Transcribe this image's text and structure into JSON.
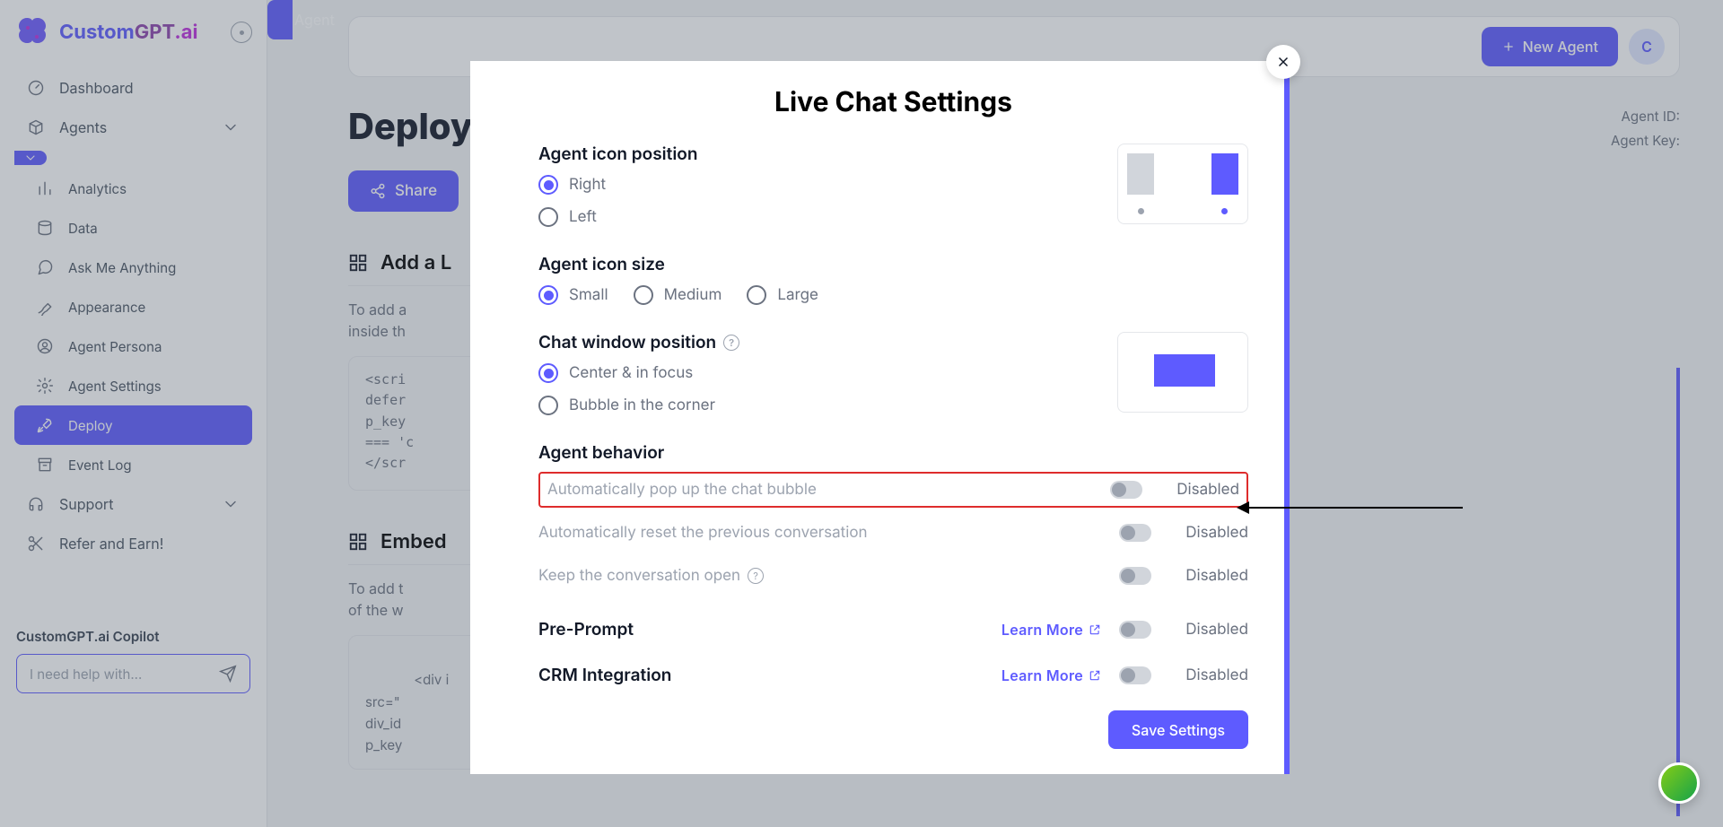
{
  "brand": {
    "part1": "Custom",
    "part2": "GPT",
    "part3": ".ai"
  },
  "sidebar": {
    "dashboard": "Dashboard",
    "agents": "Agents",
    "agent": "Agent",
    "analytics": "Analytics",
    "data": "Data",
    "ask": "Ask Me Anything",
    "appearance": "Appearance",
    "persona": "Agent Persona",
    "settings": "Agent Settings",
    "deploy": "Deploy",
    "eventlog": "Event Log",
    "support": "Support",
    "refer": "Refer and Earn!",
    "copilot_title": "CustomGPT.ai Copilot",
    "copilot_placeholder": "I need help with..."
  },
  "topbar": {
    "new_agent": "New Agent",
    "avatar_initial": "C"
  },
  "page": {
    "title": "Deploy",
    "agent_id_label": "Agent ID:",
    "agent_key_label": "Agent Key:",
    "share": "Share"
  },
  "deploy_sections": {
    "livechat_title": "Add a L",
    "livechat_desc": "To add a\ninside th",
    "livechat_code": "<scri\ndefer\np_key\n=== 'c\n</scr",
    "embed_title": "Embed",
    "embed_desc": "To add t\nof the w",
    "embed_code": "<div i\nsrc=\"\ndiv_id\np_key"
  },
  "modal": {
    "title": "Live Chat Settings",
    "icon_position": {
      "label": "Agent icon position",
      "right": "Right",
      "left": "Left"
    },
    "icon_size": {
      "label": "Agent icon size",
      "small": "Small",
      "medium": "Medium",
      "large": "Large"
    },
    "window_pos": {
      "label": "Chat window position",
      "center": "Center & in focus",
      "bubble": "Bubble in the corner"
    },
    "behavior": {
      "label": "Agent behavior",
      "auto_popup": "Automatically pop up the chat bubble",
      "auto_reset": "Automatically reset the previous conversation",
      "keep_open": "Keep the conversation open",
      "status": "Disabled"
    },
    "pre_prompt": {
      "label": "Pre-Prompt",
      "learn": "Learn More",
      "status": "Disabled"
    },
    "crm": {
      "label": "CRM Integration",
      "learn": "Learn More",
      "status": "Disabled"
    },
    "save": "Save Settings"
  }
}
